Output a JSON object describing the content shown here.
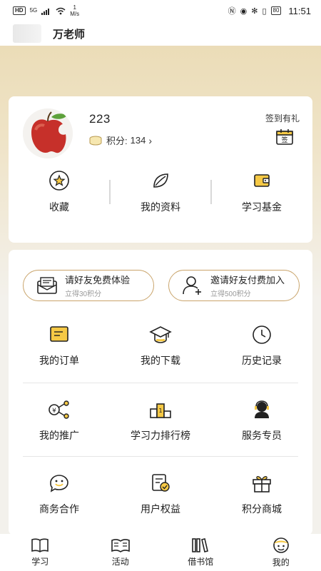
{
  "status_bar": {
    "hd": "HD",
    "signal": "5G",
    "speed_value": "1",
    "speed_unit": "M/s",
    "battery": "80",
    "time": "11:51"
  },
  "header": {
    "title": "万老师"
  },
  "profile": {
    "username": "223",
    "points_label": "积分:",
    "points_value": "134",
    "checkin_label": "签到有礼",
    "checkin_icon_text": "签"
  },
  "quick_links": [
    {
      "label": "收藏",
      "icon": "star-icon"
    },
    {
      "label": "我的资料",
      "icon": "leaf-icon"
    },
    {
      "label": "学习基金",
      "icon": "wallet-icon"
    }
  ],
  "invite": [
    {
      "main": "请好友免费体验",
      "sub": "立得30积分",
      "icon": "envelope-icon"
    },
    {
      "main": "邀请好友付费加入",
      "sub": "立得500积分",
      "icon": "add-user-icon"
    }
  ],
  "menu_rows": [
    [
      {
        "label": "我的订单",
        "icon": "order-icon"
      },
      {
        "label": "我的下载",
        "icon": "graduation-cap-icon"
      },
      {
        "label": "历史记录",
        "icon": "clock-icon"
      }
    ],
    [
      {
        "label": "我的推广",
        "icon": "share-icon"
      },
      {
        "label": "学习力排行榜",
        "icon": "podium-icon"
      },
      {
        "label": "服务专员",
        "icon": "support-agent-icon"
      }
    ],
    [
      {
        "label": "商务合作",
        "icon": "chat-smile-icon"
      },
      {
        "label": "用户权益",
        "icon": "benefits-icon"
      },
      {
        "label": "积分商城",
        "icon": "gift-icon"
      }
    ]
  ],
  "tabs": [
    {
      "label": "学习",
      "icon": "book-icon"
    },
    {
      "label": "活动",
      "icon": "open-book-icon"
    },
    {
      "label": "借书馆",
      "icon": "library-icon"
    },
    {
      "label": "我的",
      "icon": "me-icon"
    }
  ],
  "colors": {
    "accent": "#f6c945",
    "border_gold": "#c9a46b",
    "header_bg": "#e9d9b0"
  }
}
